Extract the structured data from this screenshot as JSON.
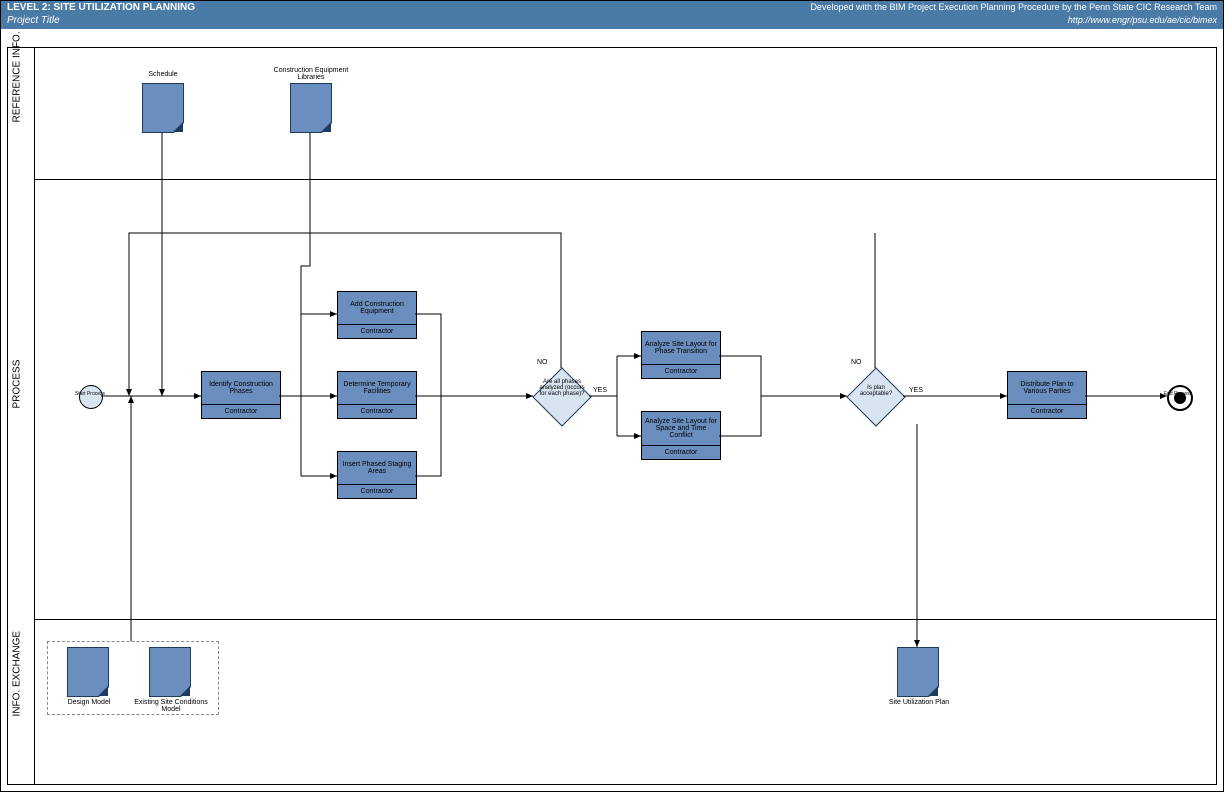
{
  "header": {
    "title": "LEVEL 2:  SITE UTILIZATION PLANNING",
    "subtitle": "Project Title",
    "credit": "Developed with the BIM Project Execution Planning Procedure by the Penn State CIC Research Team",
    "url": "http://www.engr/psu.edu/ae/cic/bimex"
  },
  "lanes": {
    "ref": "REFERENCE INFO.",
    "proc": "PROCESS",
    "exch": "INFO. EXCHANGE"
  },
  "docs": {
    "schedule": "Schedule",
    "equip": "Construction Equipment Libraries",
    "design": "Design Model",
    "existing": "Existing Site Conditions Model",
    "siteplan": "Site Utilization Plan"
  },
  "tasks": {
    "identify": {
      "name": "Identify Construction Phases",
      "role": "Contractor"
    },
    "addEquip": {
      "name": "Add Construction Equipment",
      "role": "Contractor"
    },
    "tempFac": {
      "name": "Determine Temporary Facilities",
      "role": "Contractor"
    },
    "staging": {
      "name": "Insert Phased Staging Areas",
      "role": "Contractor"
    },
    "phaseTrans": {
      "name": "Analyze Site Layout for Phase Transition",
      "role": "Contractor"
    },
    "spaceTime": {
      "name": "Analyze Site Layout for Space and Time Conflict",
      "role": "Contractor"
    },
    "distribute": {
      "name": "Distribute Plan to Various Parties",
      "role": "Contractor"
    }
  },
  "gateways": {
    "g1": "Are all phases analyzed (occurs for each phase)?",
    "g2": "Is plan acceptable?"
  },
  "events": {
    "start": "Start Process",
    "end": "End Process"
  },
  "labels": {
    "yes": "YES",
    "no": "NO"
  }
}
